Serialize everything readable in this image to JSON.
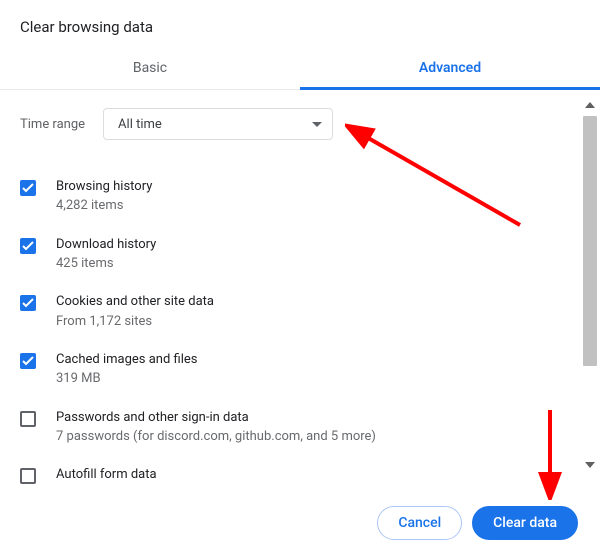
{
  "title": "Clear browsing data",
  "tabs": {
    "basic": "Basic",
    "advanced": "Advanced"
  },
  "timerange": {
    "label": "Time range",
    "value": "All time"
  },
  "options": [
    {
      "checked": true,
      "label": "Browsing history",
      "sub": "4,282 items"
    },
    {
      "checked": true,
      "label": "Download history",
      "sub": "425 items"
    },
    {
      "checked": true,
      "label": "Cookies and other site data",
      "sub": "From 1,172 sites"
    },
    {
      "checked": true,
      "label": "Cached images and files",
      "sub": "319 MB"
    },
    {
      "checked": false,
      "label": "Passwords and other sign-in data",
      "sub": "7 passwords (for discord.com, github.com, and 5 more)"
    },
    {
      "checked": false,
      "label": "Autofill form data",
      "sub": ""
    }
  ],
  "buttons": {
    "cancel": "Cancel",
    "clear": "Clear data"
  }
}
